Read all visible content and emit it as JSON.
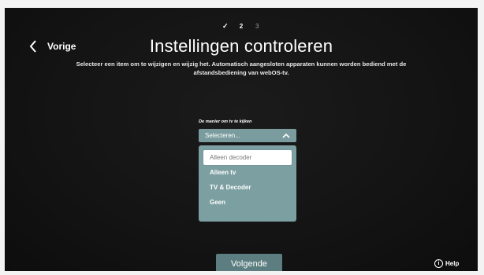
{
  "steps": {
    "done_mark": "✓",
    "current": "2",
    "next": "3"
  },
  "nav": {
    "back_label": "Vorige",
    "back_icon": "chevron-left-icon"
  },
  "header": {
    "title": "Instellingen controleren",
    "subtitle": "Selecteer een item om te wijzigen en wijzig het. Automatisch aangesloten apparaten kunnen worden bediend met de afstandsbediening van webOS-tv."
  },
  "tv_mode": {
    "label": "De manier om tv te kijken",
    "select_value": "Selecteren...",
    "select_icon": "chevron-up-icon",
    "options": [
      "Alleen decoder",
      "Alleen tv",
      "TV & Decoder",
      "Geen"
    ],
    "selected_index": 0
  },
  "footer": {
    "next_label": "Volgende",
    "help_label": "Help",
    "help_icon_glyph": "i"
  },
  "colors": {
    "screen_bg": "#121212",
    "accent": "#7a9c9e",
    "button": "#5d7e80"
  }
}
